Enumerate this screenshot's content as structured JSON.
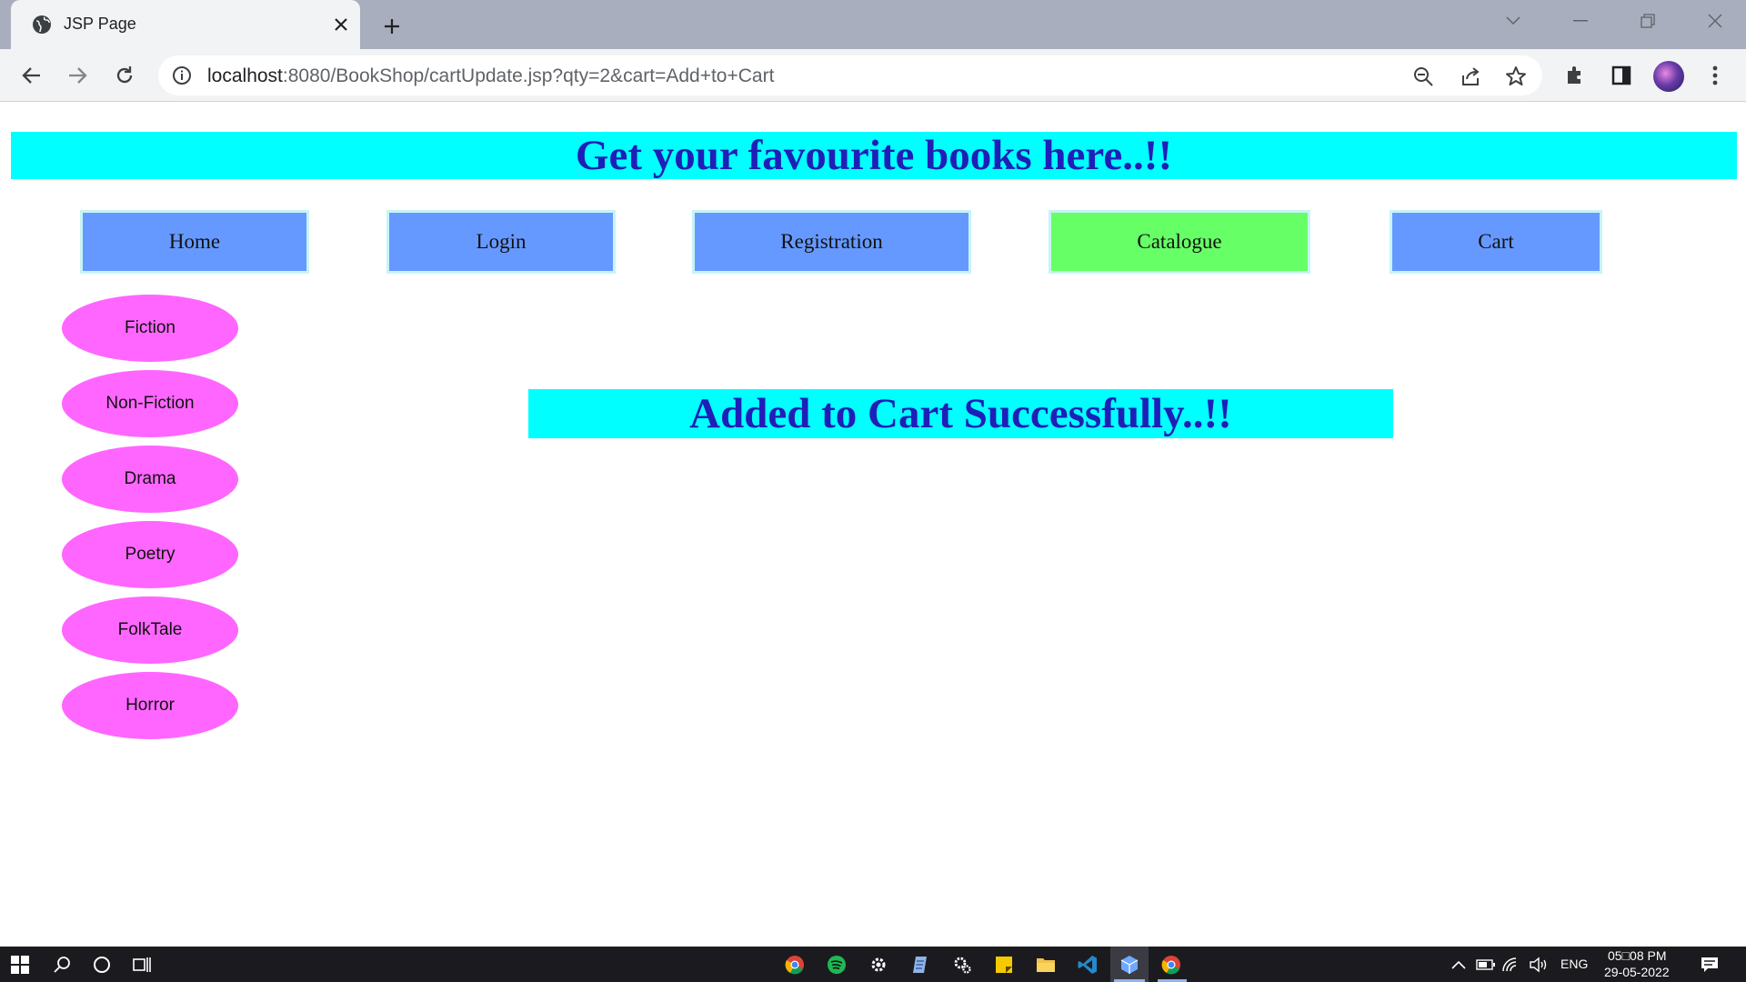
{
  "browser": {
    "tab_title": "JSP Page",
    "url_host": "localhost",
    "url_rest": ":8080/BookShop/cartUpdate.jsp?qty=2&cart=Add+to+Cart",
    "icons": [
      "globe-icon",
      "close-icon",
      "plus-icon",
      "back-icon",
      "forward-icon",
      "reload-icon",
      "info-icon",
      "zoom-out-icon",
      "share-icon",
      "star-icon",
      "extensions-icon",
      "side-panel-icon",
      "avatar",
      "more-icon",
      "tab-search-icon",
      "minimize-icon",
      "restore-icon",
      "window-close-icon"
    ]
  },
  "page": {
    "banner": "Get your favourite books here..!!",
    "nav": [
      {
        "label": "Home"
      },
      {
        "label": "Login"
      },
      {
        "label": "Registration"
      },
      {
        "label": "Catalogue",
        "active": true
      },
      {
        "label": "Cart"
      }
    ],
    "genres": [
      "Fiction",
      "Non-Fiction",
      "Drama",
      "Poetry",
      "FolkTale",
      "Horror"
    ],
    "message": "Added to Cart Successfully..!!",
    "colors": {
      "banner_bg": "#00ffff",
      "banner_text": "#1f1fb8",
      "nav_bg": "#6699ff",
      "nav_active_bg": "#66ff66",
      "genre_bg": "#ff66ff"
    }
  },
  "taskbar": {
    "lang": "ENG",
    "time": "05□08 PM",
    "date": "29-05-2022",
    "icons": [
      "windows-start-icon",
      "search-icon",
      "cortana-icon",
      "task-view-icon",
      "chrome-icon",
      "spotify-icon",
      "settings-icon",
      "notepad-icon",
      "gear-app-icon",
      "sticky-notes-icon",
      "file-explorer-icon",
      "vscode-icon",
      "cube-app-icon",
      "chrome-active-icon",
      "tray-chevron-icon",
      "battery-icon",
      "network-icon",
      "volume-icon",
      "notification-icon"
    ]
  }
}
